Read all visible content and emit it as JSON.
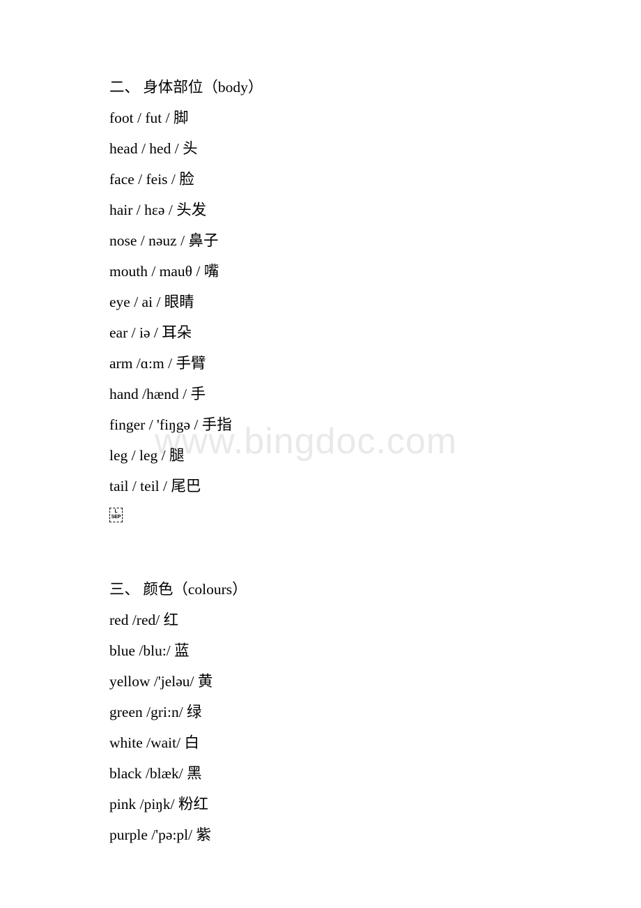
{
  "document": {
    "watermark": "www.bingdoc.com",
    "watermark_color": "#e9e9e9",
    "text_color": "#000000",
    "background_color": "#ffffff"
  },
  "sections": [
    {
      "heading": "二、 身体部位（body）",
      "entries": [
        "foot / fut / 脚",
        "head / hed / 头",
        "face / feis / 脸",
        "hair / hɛə / 头发",
        "nose / nəuz / 鼻子",
        "mouth / mauθ / 嘴",
        "eye / ai / 眼睛",
        "ear / iə / 耳朵",
        "arm /ɑ:m / 手臂",
        "hand /hænd / 手",
        "finger / 'fiŋgə / 手指",
        "leg / leg / 腿",
        "tail / teil / 尾巴"
      ],
      "separator_glyph": {
        "top": "L",
        "bottom": "SEP"
      }
    },
    {
      "heading": "三、 颜色（colours）",
      "entries": [
        "red /red/ 红",
        "blue /blu:/ 蓝",
        "yellow /'jeləu/ 黄",
        "green /gri:n/ 绿",
        "white /wait/ 白",
        "black /blæk/ 黑",
        "pink /piŋk/ 粉红",
        "purple /'pə:pl/ 紫"
      ]
    }
  ]
}
